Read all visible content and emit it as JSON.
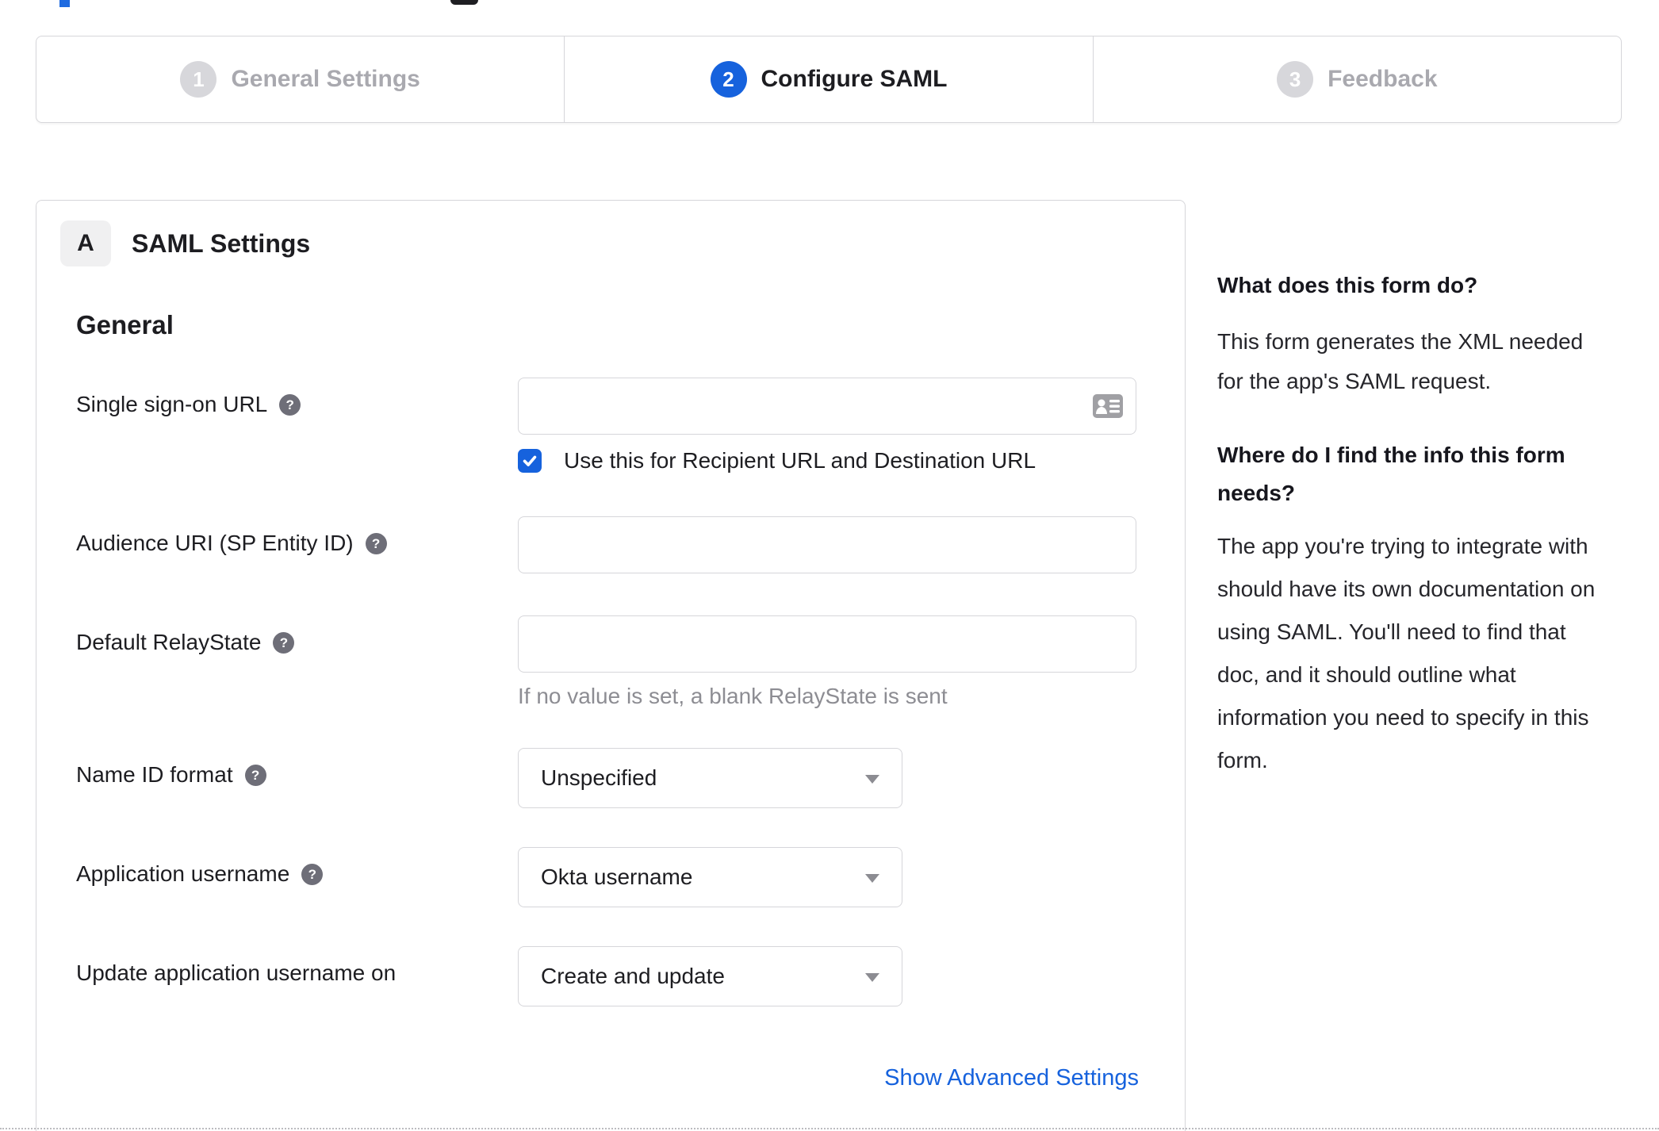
{
  "ui": {
    "help_glyph": "?"
  },
  "stepper": {
    "steps": [
      {
        "number": "1",
        "label": "General Settings",
        "state": "inactive"
      },
      {
        "number": "2",
        "label": "Configure SAML",
        "state": "active"
      },
      {
        "number": "3",
        "label": "Feedback",
        "state": "inactive"
      }
    ]
  },
  "panel": {
    "section_badge": "A",
    "section_title": "SAML Settings",
    "group_title": "General",
    "fields": {
      "sso_url": {
        "label": "Single sign-on URL",
        "value": "",
        "checkbox": {
          "checked": true,
          "label": "Use this for Recipient URL and Destination URL"
        }
      },
      "audience_uri": {
        "label": "Audience URI (SP Entity ID)",
        "value": ""
      },
      "default_relay_state": {
        "label": "Default RelayState",
        "value": "",
        "hint": "If no value is set, a blank RelayState is sent"
      },
      "name_id_format": {
        "label": "Name ID format",
        "value": "Unspecified"
      },
      "application_username": {
        "label": "Application username",
        "value": "Okta username"
      },
      "update_application_username_on": {
        "label": "Update application username on",
        "value": "Create and update"
      }
    },
    "advanced_link": "Show Advanced Settings"
  },
  "sidebar": {
    "q1": "What does this form do?",
    "a1_lines": [
      "This form generates the XML needed",
      "for the app's SAML request."
    ],
    "q2_lines": [
      "Where do I find the info this form",
      "needs?"
    ],
    "a2_lines": [
      "The app you're trying to integrate with",
      "should have its own documentation on",
      "using SAML. You'll need to find that",
      "doc, and it should outline what",
      "information you need to specify in this",
      "form."
    ]
  },
  "colors": {
    "accent_blue": "#1662dd",
    "inactive_gray": "#a9a9af",
    "border_gray": "#d6d6da",
    "help_icon_gray": "#6e6e78",
    "hint_gray": "#8d8d93",
    "text_dark": "#1d1d21"
  }
}
